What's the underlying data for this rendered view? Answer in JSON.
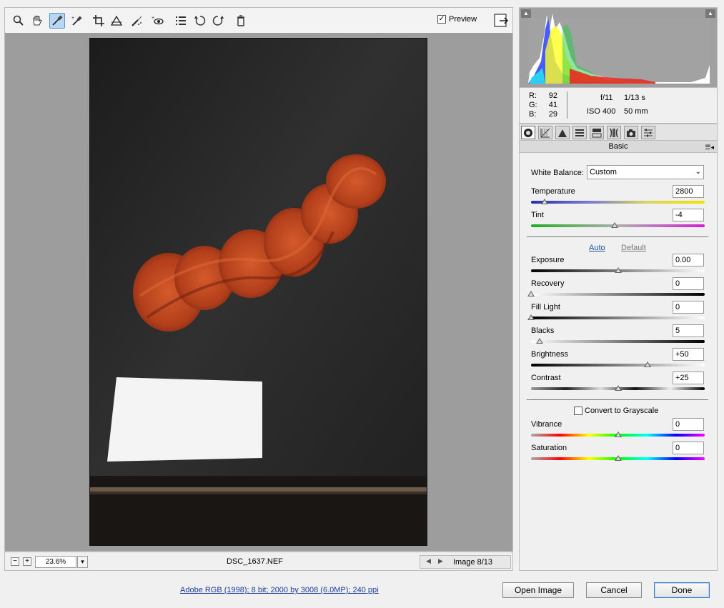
{
  "toolbar": {
    "tools": [
      "zoom-tool",
      "hand-tool",
      "white-balance-tool",
      "color-sampler-tool",
      "crop-tool",
      "straighten-tool",
      "retouch-tool",
      "red-eye-tool",
      "preferences",
      "rotate-left",
      "rotate-right",
      "delete"
    ],
    "active_tool": "white-balance-tool",
    "preview_label": "Preview",
    "preview_checked": true
  },
  "status": {
    "zoom": "23.6%",
    "filename": "DSC_1637.NEF",
    "image_count": "Image 8/13"
  },
  "readout": {
    "r_label": "R:",
    "r": "92",
    "g_label": "G:",
    "g": "41",
    "b_label": "B:",
    "b": "29",
    "aperture": "f/11",
    "shutter": "1/13 s",
    "iso": "ISO 400",
    "focal": "50 mm"
  },
  "panel": {
    "title": "Basic",
    "white_balance_label": "White Balance:",
    "white_balance_value": "Custom",
    "auto_label": "Auto",
    "default_label": "Default",
    "grayscale_label": "Convert to Grayscale",
    "grayscale_checked": false,
    "sliders": {
      "temperature": {
        "label": "Temperature",
        "value": "2800",
        "level": 0.08
      },
      "tint": {
        "label": "Tint",
        "value": "-4",
        "level": 0.48
      },
      "exposure": {
        "label": "Exposure",
        "value": "0.00",
        "level": 0.5
      },
      "recovery": {
        "label": "Recovery",
        "value": "0",
        "level": 0.0
      },
      "fill_light": {
        "label": "Fill Light",
        "value": "0",
        "level": 0.0
      },
      "blacks": {
        "label": "Blacks",
        "value": "5",
        "level": 0.05
      },
      "brightness": {
        "label": "Brightness",
        "value": "+50",
        "level": 0.67
      },
      "contrast": {
        "label": "Contrast",
        "value": "+25",
        "level": 0.5
      },
      "vibrance": {
        "label": "Vibrance",
        "value": "0",
        "level": 0.5
      },
      "saturation": {
        "label": "Saturation",
        "value": "0",
        "level": 0.5
      }
    }
  },
  "footer": {
    "info_link": "Adobe RGB (1998); 8 bit; 2000 by 3008 (6.0MP); 240 ppi",
    "open_image": "Open Image",
    "cancel": "Cancel",
    "done": "Done"
  },
  "colors": {
    "canvas_bg": "#9d9d9d",
    "yarn": "#c2481f",
    "link": "#1a3c9a"
  }
}
